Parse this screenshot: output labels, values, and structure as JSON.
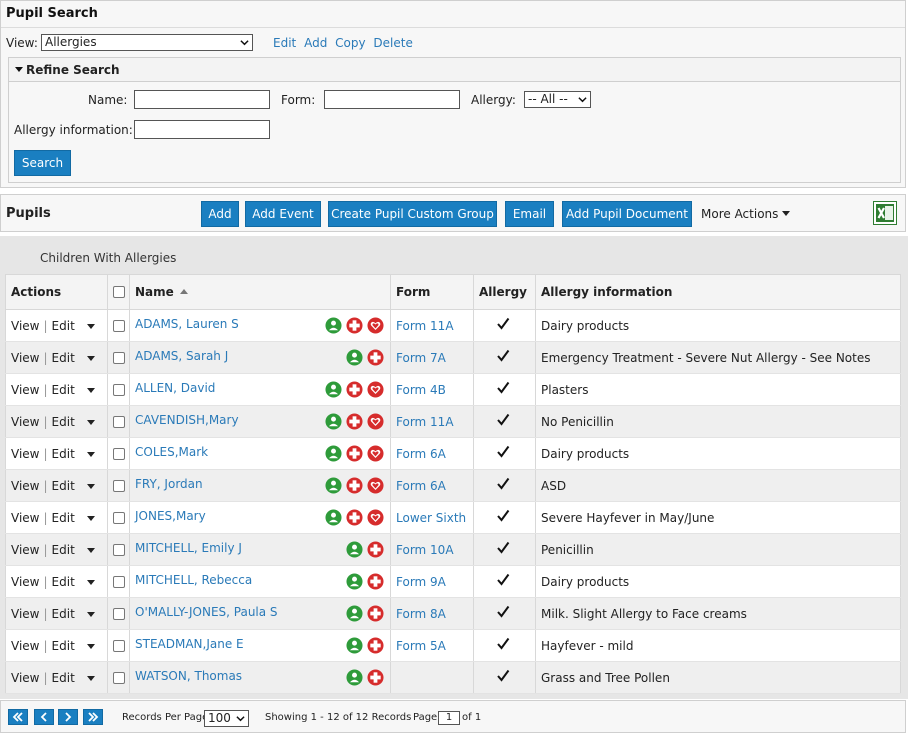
{
  "search_panel": {
    "title": "Pupil Search",
    "view_label": "View:",
    "view_value": "Allergies",
    "view_links": [
      "Edit",
      "Add",
      "Copy",
      "Delete"
    ],
    "refine_title": "Refine Search",
    "name_label": "Name:",
    "form_label": "Form:",
    "allergy_label": "Allergy:",
    "allergy_value": "-- All --",
    "allergy_info_label": "Allergy information:",
    "search_button": "Search"
  },
  "toolbar": {
    "title": "Pupils",
    "buttons": [
      "Add",
      "Add Event",
      "Create Pupil Custom Group",
      "Email",
      "Add Pupil Document"
    ],
    "more_actions": "More Actions"
  },
  "grid": {
    "caption": "Children With Allergies",
    "headers": {
      "actions": "Actions",
      "name": "Name",
      "form": "Form",
      "allergy": "Allergy",
      "allergy_info": "Allergy information"
    },
    "action_view": "View",
    "action_edit": "Edit",
    "rows": [
      {
        "name": "ADAMS, Lauren S",
        "form": "Form 11A",
        "info": "Dairy products",
        "heart": true
      },
      {
        "name": "ADAMS, Sarah J",
        "form": "Form 7A",
        "info": "Emergency Treatment - Severe Nut Allergy - See Notes",
        "heart": false
      },
      {
        "name": "ALLEN, David",
        "form": "Form 4B",
        "info": "Plasters",
        "heart": true
      },
      {
        "name": "CAVENDISH,Mary",
        "form": "Form 11A",
        "info": "No Penicillin",
        "heart": true
      },
      {
        "name": "COLES,Mark",
        "form": "Form 6A",
        "info": "Dairy products",
        "heart": true
      },
      {
        "name": "FRY, Jordan",
        "form": "Form 6A",
        "info": "ASD",
        "heart": true
      },
      {
        "name": "JONES,Mary",
        "form": "Lower Sixth",
        "info": "Severe Hayfever in May/June",
        "heart": true
      },
      {
        "name": "MITCHELL, Emily J",
        "form": "Form 10A",
        "info": "Penicillin",
        "heart": false
      },
      {
        "name": "MITCHELL, Rebecca",
        "form": "Form 9A",
        "info": "Dairy products",
        "heart": false
      },
      {
        "name": "O'MALLY-JONES, Paula S",
        "form": "Form 8A",
        "info": "Milk. Slight Allergy to Face creams",
        "heart": false
      },
      {
        "name": "STEADMAN,Jane E",
        "form": "Form 5A",
        "info": "Hayfever - mild",
        "heart": false
      },
      {
        "name": "WATSON, Thomas",
        "form": "",
        "info": "Grass and Tree Pollen",
        "heart": false
      }
    ]
  },
  "pager": {
    "records_per_page_label": "Records Per Page",
    "records_per_page_value": "100",
    "showing": "Showing 1 - 12 of 12 Records",
    "page_label": "Page",
    "page_value": "1",
    "of_label": "of 1"
  },
  "colors": {
    "accent_blue": "#1a7fc1",
    "link_blue": "#2a7ab8",
    "person_green": "#2e9b3a",
    "medical_red": "#d62c2c",
    "excel_green": "#2f7d32"
  },
  "icons": {
    "person": "person-icon",
    "medical": "medical-cross-icon",
    "heart": "heart-icon",
    "excel": "excel-icon"
  }
}
